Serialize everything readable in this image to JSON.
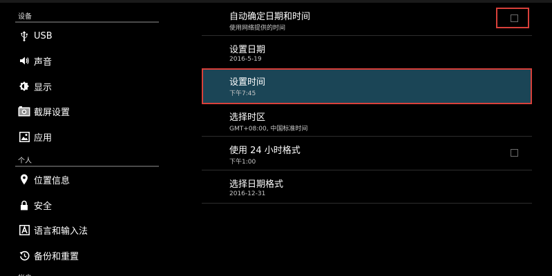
{
  "colors": {
    "background": "#000000",
    "selected_row": "#1b4556",
    "highlight_border": "#d9403a",
    "divider": "#2e2e2e"
  },
  "sidebar": {
    "sections": [
      {
        "header": "设备",
        "items": [
          {
            "label": "USB",
            "icon": "usb-icon"
          },
          {
            "label": "声音",
            "icon": "speaker-icon"
          },
          {
            "label": "显示",
            "icon": "brightness-icon"
          },
          {
            "label": "截屏设置",
            "icon": "camera-icon"
          },
          {
            "label": "应用",
            "icon": "apps-icon"
          }
        ]
      },
      {
        "header": "个人",
        "items": [
          {
            "label": "位置信息",
            "icon": "location-icon"
          },
          {
            "label": "安全",
            "icon": "lock-icon"
          },
          {
            "label": "语言和输入法",
            "icon": "language-icon"
          },
          {
            "label": "备份和重置",
            "icon": "backup-icon"
          }
        ]
      },
      {
        "header": "帐户"
      }
    ]
  },
  "settings": {
    "items": [
      {
        "title": "自动确定日期和时间",
        "summary": "使用网络提供的时间",
        "checkbox": "unchecked"
      },
      {
        "title": "设置日期",
        "summary": "2016-5-19"
      },
      {
        "title": "设置时间",
        "summary": "下午7:45",
        "state": "selected"
      },
      {
        "title": "选择时区",
        "summary": "GMT+08:00, 中国标准时间"
      },
      {
        "title": "使用 24 小时格式",
        "summary": "下午1:00",
        "checkbox": "unchecked"
      },
      {
        "title": "选择日期格式",
        "summary": "2016-12-31"
      }
    ]
  }
}
